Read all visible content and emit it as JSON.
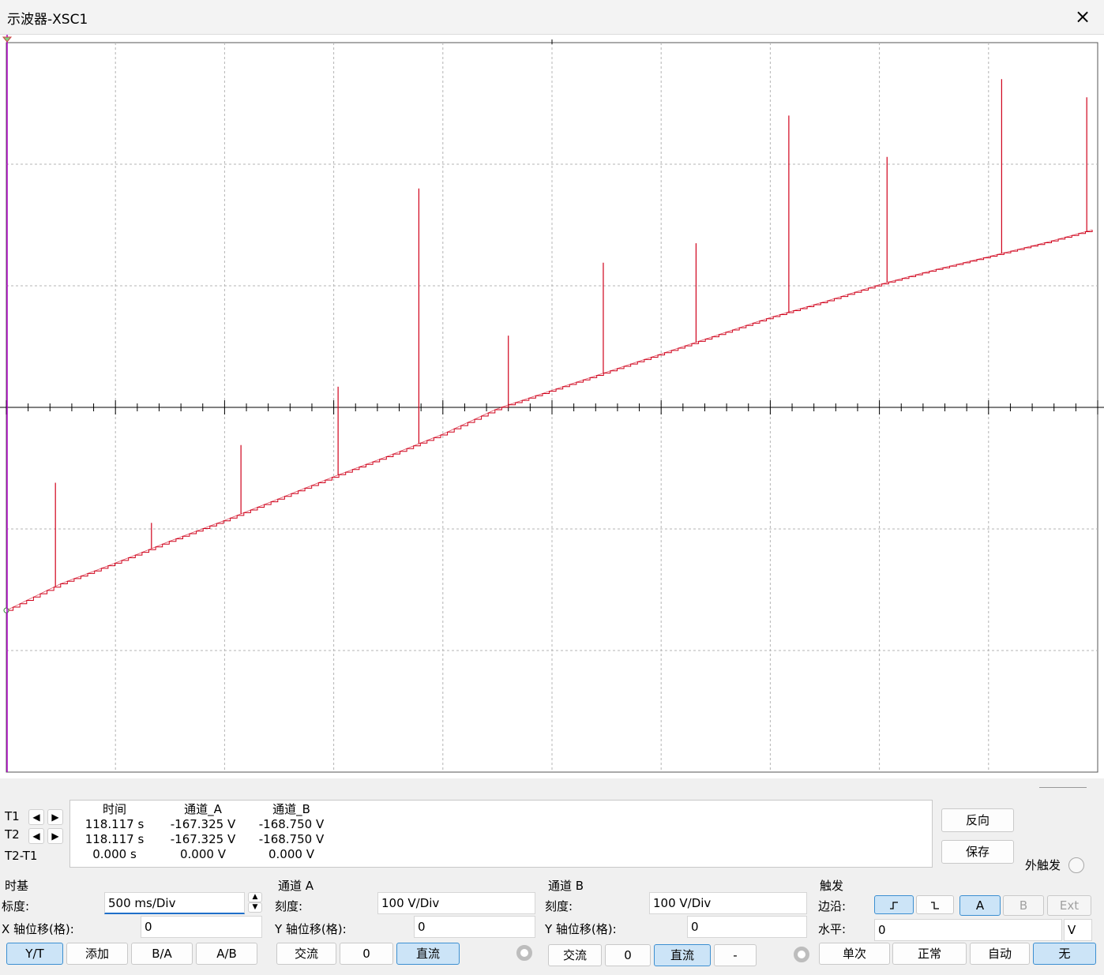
{
  "window": {
    "title": "示波器-XSC1",
    "close_icon": "×"
  },
  "readout": {
    "rows": {
      "t1": "T1",
      "t2": "T2",
      "t2t1": "T2-T1"
    },
    "headers": {
      "time": "时间",
      "channel_a": "通道_A",
      "channel_b": "通道_B"
    },
    "values": {
      "t1": {
        "time": "118.117 s",
        "a": "-167.325 V",
        "b": "-168.750 V"
      },
      "t2": {
        "time": "118.117 s",
        "a": "-167.325 V",
        "b": "-168.750 V"
      },
      "t2t1": {
        "time": "0.000 s",
        "a": "0.000 V",
        "b": "0.000 V"
      }
    },
    "reverse_button": "反向",
    "save_button": "保存",
    "ext_trigger_label": "外触发"
  },
  "timebase": {
    "title": "时基",
    "scale_label": "标度:",
    "scale_value": "500 ms/Div",
    "xpos_label": "X 轴位移(格):",
    "xpos_value": "0",
    "modes": [
      "Y/T",
      "添加",
      "B/A",
      "A/B"
    ],
    "active_mode": "Y/T"
  },
  "channel_a": {
    "title": "通道 A",
    "scale_label": "刻度:",
    "scale_value": "100  V/Div",
    "ypos_label": "Y 轴位移(格):",
    "ypos_value": "0",
    "coupling": [
      "交流",
      "0",
      "直流"
    ],
    "active_coupling": "直流"
  },
  "channel_b": {
    "title": "通道 B",
    "scale_label": "刻度:",
    "scale_value": "100  V/Div",
    "ypos_label": "Y 轴位移(格):",
    "ypos_value": "0",
    "coupling": [
      "交流",
      "0",
      "直流",
      "-"
    ],
    "active_coupling": "直流"
  },
  "trigger": {
    "title": "触发",
    "edge_label": "边沿:",
    "edge_rising_icon": "rising-edge-icon",
    "edge_falling_icon": "falling-edge-icon",
    "sources": [
      "A",
      "B",
      "Ext"
    ],
    "active_source": "A",
    "level_label": "水平:",
    "level_value": "0",
    "level_unit": "V",
    "modes": [
      "单次",
      "正常",
      "自动",
      "无"
    ],
    "active_mode": "无"
  },
  "colors": {
    "trace_a": "#d0021b",
    "cursor": "#b000c8",
    "grid": "#b4b4b4",
    "active": "#cce4f7"
  },
  "chart_data": {
    "type": "line",
    "title": "",
    "xlabel": "",
    "ylabel": "",
    "x_divisions": 10,
    "y_divisions": 6,
    "x_div_value": "500 ms/Div",
    "y_div_value": "100 V/Div",
    "series": [
      {
        "name": "",
        "x": [
          0,
          0.5,
          1,
          1.5,
          2,
          2.5,
          3,
          3.5,
          4,
          4.5,
          5,
          5.5,
          6,
          6.5,
          7,
          7.5,
          8,
          8.5,
          9,
          9.5,
          9.95
        ],
        "y": [
          -167,
          -145,
          -128,
          -110,
          -93,
          -75,
          -57,
          -40,
          -22,
          -1,
          14,
          29,
          44,
          59,
          74,
          87,
          101,
          113,
          124,
          135,
          146
        ]
      }
    ],
    "spikes": [
      {
        "x": 0.45,
        "y_top": -62
      },
      {
        "x": 3.78,
        "y_top": 180
      },
      {
        "x": 2.15,
        "y_top": -31
      },
      {
        "x": 5.47,
        "y_top": 119
      },
      {
        "x": 7.17,
        "y_top": 240
      },
      {
        "x": 6.32,
        "y_top": 135
      },
      {
        "x": 9.12,
        "y_top": 270
      },
      {
        "x": 8.07,
        "y_top": 206
      },
      {
        "x": 4.6,
        "y_top": 59
      },
      {
        "x": 1.33,
        "y_top": -95
      },
      {
        "x": 9.9,
        "y_top": 255
      },
      {
        "x": 3.04,
        "y_top": 17
      }
    ]
  }
}
